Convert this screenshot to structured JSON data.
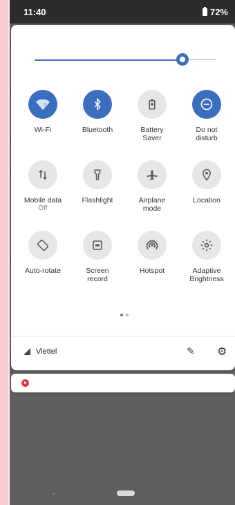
{
  "status": {
    "time": "11:40",
    "battery": "72%"
  },
  "brightness": {
    "level": 0.82
  },
  "tiles": [
    {
      "label": "Wi-Fi",
      "icon": "wifi-question-icon",
      "active": true
    },
    {
      "label": "Bluetooth",
      "icon": "bluetooth-icon",
      "active": true
    },
    {
      "label": "Battery Saver",
      "icon": "battery-saver-icon",
      "active": false
    },
    {
      "label": "Do not disturb",
      "icon": "do-not-disturb-icon",
      "active": true
    },
    {
      "label": "Mobile data",
      "sub": "Off",
      "icon": "mobile-data-icon",
      "active": false
    },
    {
      "label": "Flashlight",
      "icon": "flashlight-icon",
      "active": false
    },
    {
      "label": "Airplane mode",
      "icon": "airplane-icon",
      "active": false
    },
    {
      "label": "Location",
      "icon": "location-icon",
      "active": false
    },
    {
      "label": "Auto-rotate",
      "icon": "auto-rotate-icon",
      "active": false
    },
    {
      "label": "Screen record",
      "icon": "screen-record-icon",
      "active": false
    },
    {
      "label": "Hotspot",
      "icon": "hotspot-icon",
      "active": false
    },
    {
      "label": "Adaptive Brightness",
      "icon": "adaptive-brightness-icon",
      "active": false
    }
  ],
  "footer": {
    "carrier": "Viettel"
  },
  "colors": {
    "accent": "#3c6ec0",
    "notification": "#d93a43"
  }
}
